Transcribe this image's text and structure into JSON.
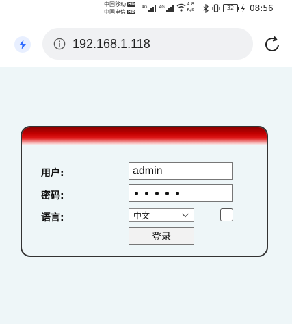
{
  "status_bar": {
    "carrier1": "中国移动",
    "carrier2": "中国电信",
    "hd_badge": "HD",
    "net_type": "4G",
    "speed_value": "4.8",
    "speed_unit": "K/s",
    "battery": "32",
    "time": "08:56"
  },
  "browser": {
    "url": "192.168.1.118",
    "icons": [
      "bolt-icon",
      "info-icon",
      "reload-icon"
    ]
  },
  "login": {
    "user_label": "用户:",
    "username": "admin",
    "password_label": "密码:",
    "password_dot_count": 5,
    "language_label": "语言:",
    "language_selected": "中文",
    "remember_checked": false,
    "login_button": "登录"
  },
  "colors": {
    "page_bg": "#eef6f8",
    "header_red": "#c40000",
    "url_field_bg": "#f0f1f3",
    "bolt_blue": "#2f6bff"
  }
}
